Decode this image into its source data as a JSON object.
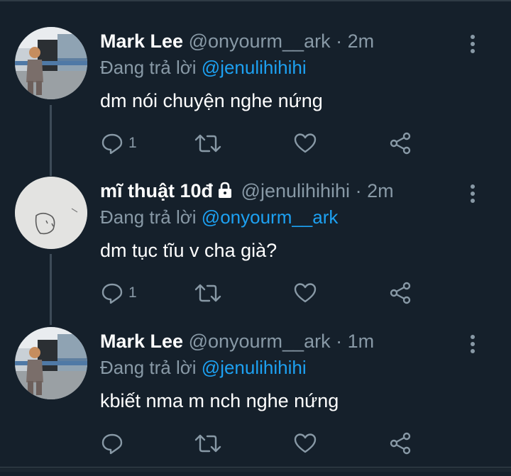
{
  "tweets": [
    {
      "name": "Mark Lee",
      "handle": "@onyourm__ark",
      "time": "2m",
      "reply_prefix": "Đang trả lời",
      "reply_to": "@jenulihihihi",
      "text": "dm nói chuyện nghe nứng",
      "reply_count": "1",
      "locked": false,
      "avatar": "mark-photo"
    },
    {
      "name": "mĩ thuật 10đ",
      "handle": "@jenulihihihi",
      "time": "2m",
      "reply_prefix": "Đang trả lời",
      "reply_to": "@onyourm__ark",
      "text": "dm tục tĩu v cha già?",
      "reply_count": "1",
      "locked": true,
      "avatar": "sketch"
    },
    {
      "name": "Mark Lee",
      "handle": "@onyourm__ark",
      "time": "1m",
      "reply_prefix": "Đang trả lời",
      "reply_to": "@jenulihihihi",
      "text": "kbiết nma m nch nghe nứng",
      "reply_count": "",
      "locked": false,
      "avatar": "mark-photo"
    }
  ],
  "separator": "·",
  "colors": {
    "background": "#15202b",
    "secondary_text": "#8899a6",
    "link": "#1da1f2",
    "thread_line": "#3d4b58"
  },
  "icons": [
    "reply-icon",
    "retweet-icon",
    "like-icon",
    "share-icon",
    "more-icon",
    "lock-icon"
  ]
}
